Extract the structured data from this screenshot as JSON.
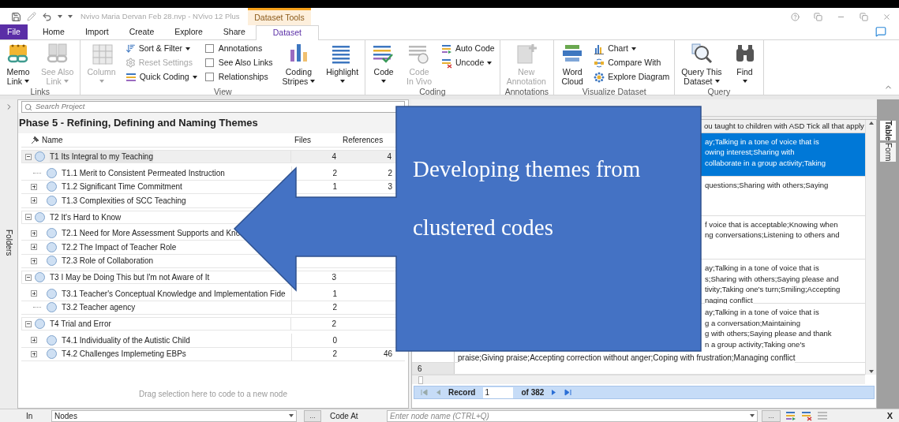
{
  "title_bar": {
    "title": "Nvivo Maria Dervan Feb 28.nvp - NVivo 12 Plus",
    "context_tab": "Dataset Tools"
  },
  "tabs": [
    {
      "label": "File",
      "kind": "file",
      "selected": false
    },
    {
      "label": "Home",
      "kind": "tab",
      "selected": false
    },
    {
      "label": "Import",
      "kind": "tab",
      "selected": false
    },
    {
      "label": "Create",
      "kind": "tab",
      "selected": false
    },
    {
      "label": "Explore",
      "kind": "tab",
      "selected": false
    },
    {
      "label": "Share",
      "kind": "tab",
      "selected": false
    },
    {
      "label": "Dataset",
      "kind": "tab",
      "selected": true
    }
  ],
  "ribbon": [
    {
      "label": "Links",
      "items": [
        {
          "kind": "large",
          "lines": [
            "Memo",
            "Link"
          ],
          "dropdown": true,
          "disabled": false
        },
        {
          "kind": "large",
          "lines": [
            "See Also",
            "Link"
          ],
          "dropdown": true,
          "disabled": true
        }
      ]
    },
    {
      "label": "View",
      "items": [
        {
          "kind": "large",
          "lines": [
            "Column"
          ],
          "dropdown": true,
          "disabled": true
        },
        {
          "kind": "stack",
          "entries": [
            {
              "label": "Sort & Filter",
              "dropdown": true,
              "disabled": false
            },
            {
              "label": "Reset Settings",
              "dropdown": false,
              "disabled": true
            },
            {
              "label": "Quick Coding",
              "dropdown": true,
              "disabled": false
            }
          ]
        },
        {
          "kind": "checks",
          "entries": [
            {
              "label": "Annotations",
              "checked": false
            },
            {
              "label": "See Also Links",
              "checked": false
            },
            {
              "label": "Relationships",
              "checked": false
            }
          ]
        },
        {
          "kind": "large",
          "lines": [
            "Coding",
            "Stripes"
          ],
          "dropdown": true,
          "disabled": false
        },
        {
          "kind": "large",
          "lines": [
            "Highlight"
          ],
          "dropdown": true,
          "disabled": false
        }
      ]
    },
    {
      "label": "Coding",
      "items": [
        {
          "kind": "large",
          "lines": [
            "Code"
          ],
          "dropdown": true,
          "disabled": false
        },
        {
          "kind": "large",
          "lines": [
            "Code",
            "In Vivo"
          ],
          "dropdown": false,
          "disabled": true
        },
        {
          "kind": "stack",
          "entries": [
            {
              "label": "Auto Code",
              "dropdown": false,
              "disabled": false
            },
            {
              "label": "Uncode",
              "dropdown": true,
              "disabled": false
            }
          ]
        }
      ]
    },
    {
      "label": "Annotations",
      "items": [
        {
          "kind": "large",
          "lines": [
            "New",
            "Annotation"
          ],
          "dropdown": false,
          "disabled": true
        }
      ]
    },
    {
      "label": "Visualize Dataset",
      "items": [
        {
          "kind": "large",
          "lines": [
            "Word",
            "Cloud"
          ],
          "dropdown": false,
          "disabled": false
        },
        {
          "kind": "stack",
          "entries": [
            {
              "label": "Chart",
              "dropdown": true,
              "disabled": false
            },
            {
              "label": "Compare With",
              "dropdown": false,
              "disabled": false
            },
            {
              "label": "Explore Diagram",
              "dropdown": false,
              "disabled": false
            }
          ]
        }
      ]
    },
    {
      "label": "Query",
      "items": [
        {
          "kind": "large",
          "lines": [
            "Query This",
            "Dataset"
          ],
          "dropdown": true,
          "disabled": false
        },
        {
          "kind": "large",
          "lines": [
            "Find"
          ],
          "dropdown": true,
          "disabled": false
        }
      ]
    }
  ],
  "navigation": {
    "label": "Folders"
  },
  "project": {
    "search_placeholder": "Search Project",
    "heading": "Phase 5 - Refining, Defining and Naming Themes",
    "columns": [
      "Name",
      "Files",
      "References"
    ],
    "themes": [
      {
        "name": "T1 Its Integral to my Teaching",
        "files": "4",
        "references": "4",
        "expanded": true,
        "selected": true,
        "children": [
          {
            "name": "T1.1 Merit to Consistent Permeated Instruction",
            "files": "2",
            "references": "2",
            "expandable": false,
            "selected": false
          },
          {
            "name": "T1.2 Significant Time Commitment",
            "files": "1",
            "references": "3",
            "expandable": true,
            "selected": false
          },
          {
            "name": "T1.3 Complexities of SCC Teaching",
            "expandable": true,
            "selected": false
          }
        ]
      },
      {
        "name": "T2 It's Hard to Know",
        "expanded": true,
        "selected": false,
        "children": [
          {
            "name": "T2.1 Need for More Assessment Supports and Kno",
            "expandable": true,
            "selected": false
          },
          {
            "name": "T2.2 The Impact of Teacher Role",
            "expandable": true,
            "selected": false
          },
          {
            "name": "T2.3 Role of Collaboration",
            "expandable": true,
            "selected": false
          }
        ]
      },
      {
        "name": "T3 I May be Doing This but I'm not Aware of It",
        "files": "3",
        "expanded": true,
        "selected": false,
        "children": [
          {
            "name": "T3.1 Teacher's Conceptual Knowledge and Implementation Fide",
            "files": "1",
            "expandable": true,
            "selected": false
          },
          {
            "name": "T3.2 Teacher agency",
            "files": "2",
            "expandable": false,
            "selected": false
          }
        ]
      },
      {
        "name": "T4 Trial and Error",
        "files": "2",
        "expanded": true,
        "selected": false,
        "children": [
          {
            "name": "T4.1 Individuality of the Autistic Child",
            "files": "0",
            "expandable": true,
            "selected": false
          },
          {
            "name": "T4.2 Challenges Implemeting EBPs",
            "files": "2",
            "references": "46",
            "expandable": true,
            "selected": false
          }
        ]
      }
    ],
    "drop_hint": "Drag selection here to code to a new node"
  },
  "dataset": {
    "header": "ou taught to children with ASD Tick all that apply",
    "rows": [
      {
        "selected": true,
        "lines": [
          "ay;Talking in a tone of voice that is",
          "owing interest;Sharing with",
          "collaborate in a group activity;Taking"
        ]
      },
      {
        "selected": false,
        "lines": [
          "questions;Sharing with others;Saying"
        ]
      },
      {
        "selected": false,
        "lines": [
          "f voice that is acceptable;Knowing when",
          "ng conversations;Listening to others and"
        ]
      },
      {
        "selected": false,
        "lines": [
          "ay;Talking in a tone of voice that is",
          "s;Sharing with others;Saying please and",
          "tivity;Taking one's turn;Smiling;Accepting",
          "naging conflict"
        ]
      },
      {
        "selected": false,
        "lines": [
          "ay;Talking in a tone of voice that is",
          "g a conversation;Maintaining",
          "g with others;Saying please and thank",
          "n a group activity;Taking one's"
        ],
        "tail": "praise;Giving praise;Accepting correction without anger;Coping with frustration;Managing conflict"
      },
      {
        "number": "6",
        "selected": false
      }
    ],
    "record": {
      "label": "Record",
      "value": "1",
      "total": "of 382"
    },
    "views": [
      {
        "label": "Table",
        "selected": true
      },
      {
        "label": "Form",
        "selected": false
      }
    ]
  },
  "code_bar": {
    "in_label": "In",
    "in_value": "Nodes",
    "browse": "...",
    "code_at_label": "Code At",
    "placeholder": "Enter node name (CTRL+Q)",
    "browse_2": "...",
    "close": "X"
  },
  "callout": {
    "lines": [
      "Developing themes from",
      "clustered codes"
    ]
  }
}
